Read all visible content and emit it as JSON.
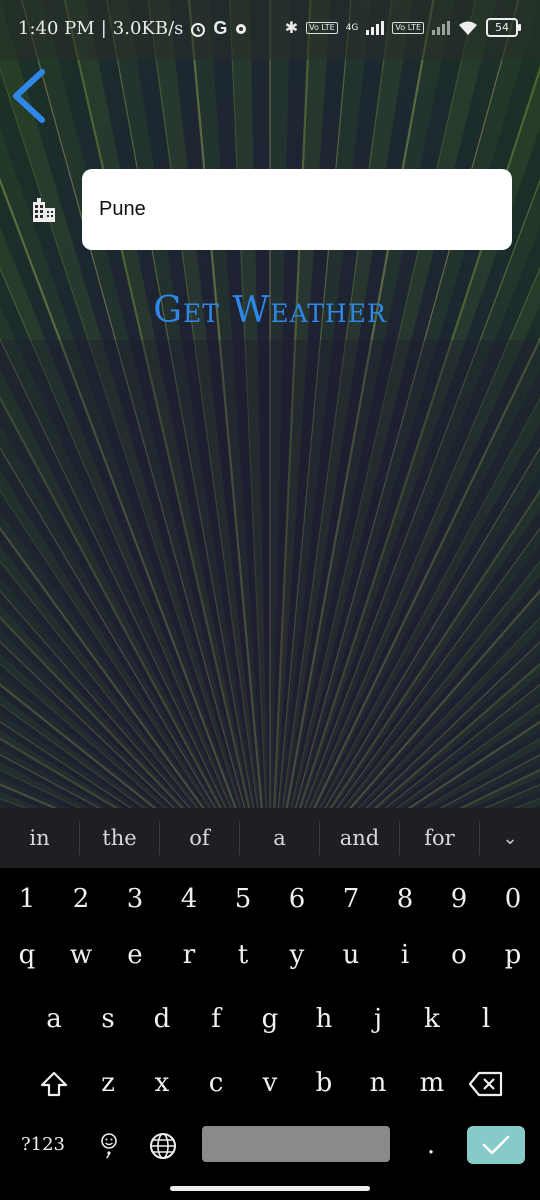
{
  "status_bar": {
    "time": "1:40 PM",
    "separator": "|",
    "speed": "3.0KB/s",
    "network_left": "Vo LTE",
    "network_type": "4G",
    "network_right": "Vo LTE",
    "battery": "54"
  },
  "form": {
    "city_value": "Pune",
    "button_label": "Get Weather",
    "accent_color": "#2f87e6"
  },
  "keyboard": {
    "suggestions": [
      "in",
      "the",
      "of",
      "a",
      "and",
      "for"
    ],
    "number_row": [
      "1",
      "2",
      "3",
      "4",
      "5",
      "6",
      "7",
      "8",
      "9",
      "0"
    ],
    "row_q": [
      "q",
      "w",
      "e",
      "r",
      "t",
      "y",
      "u",
      "i",
      "o",
      "p"
    ],
    "row_a": [
      "a",
      "s",
      "d",
      "f",
      "g",
      "h",
      "j",
      "k",
      "l"
    ],
    "row_z": [
      "z",
      "x",
      "c",
      "v",
      "b",
      "n",
      "m"
    ],
    "symbols_label": "?123",
    "period_label": ".",
    "enter_color": "#86cbc9"
  }
}
